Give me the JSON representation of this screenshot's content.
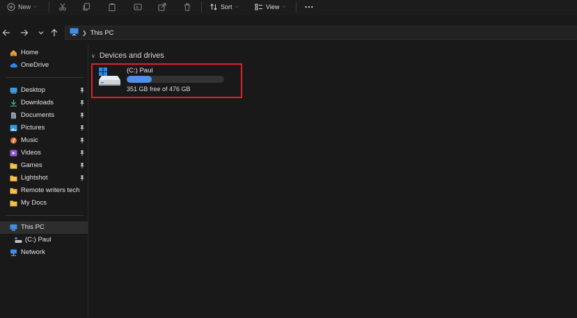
{
  "toolbar": {
    "new_label": "New",
    "sort_label": "Sort",
    "view_label": "View"
  },
  "address_bar": {
    "crumb": "This PC"
  },
  "sidebar": {
    "home": "Home",
    "onedrive": "OneDrive",
    "desktop": "Desktop",
    "downloads": "Downloads",
    "documents": "Documents",
    "pictures": "Pictures",
    "music": "Music",
    "videos": "Videos",
    "games": "Games",
    "lightshot": "Lightshot",
    "remote_writers": "Remote writers tech",
    "my_docs": "My Docs",
    "this_pc": "This PC",
    "c_drive": "(C:) Paul",
    "network": "Network"
  },
  "content": {
    "group_title": "Devices and drives",
    "drive": {
      "name": "(C:) Paul",
      "free_text": "351 GB free of 476 GB",
      "used_fraction": 0.26
    }
  },
  "colors": {
    "accent": "#4f8fe8",
    "highlight": "#e0202a",
    "folder": "#f2c14e"
  }
}
